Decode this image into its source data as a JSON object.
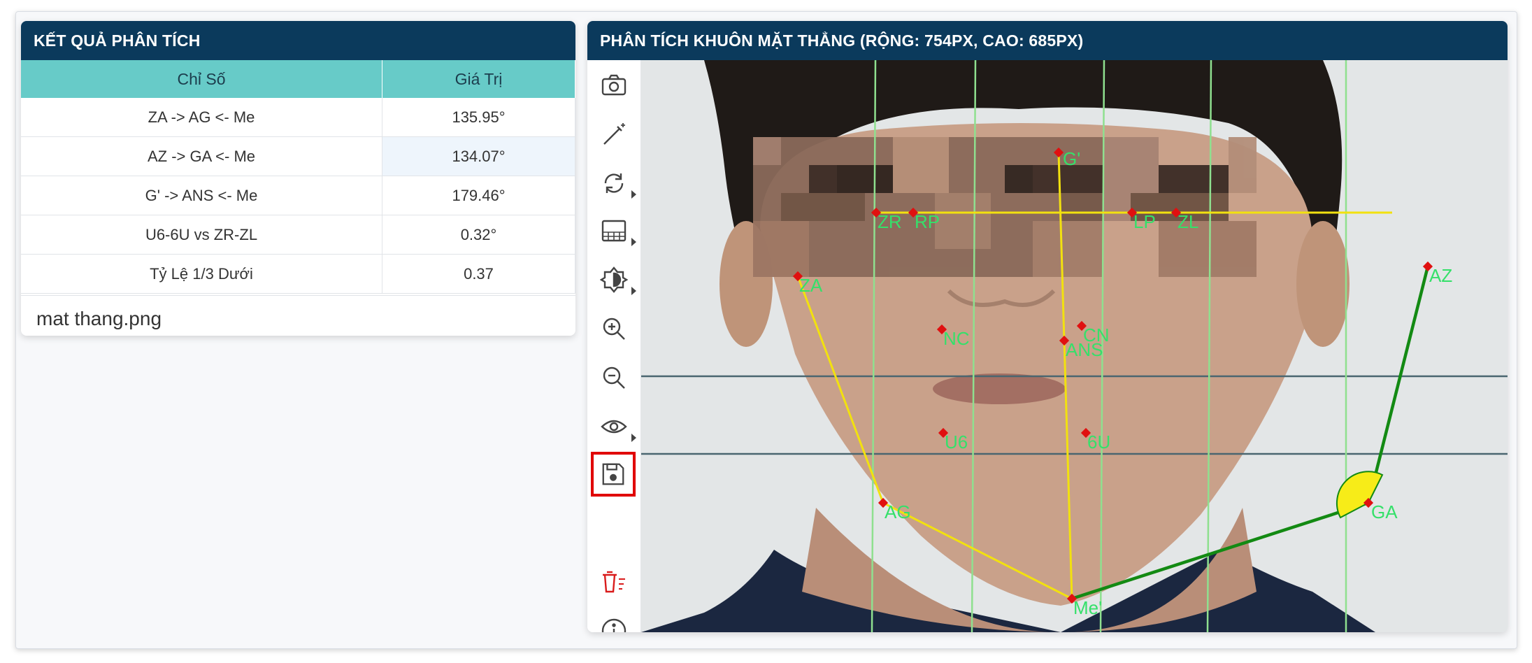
{
  "left_panel": {
    "title": "KẾT QUẢ PHÂN TÍCH",
    "columns": [
      "Chỉ Số",
      "Giá Trị"
    ],
    "rows": [
      {
        "index": "ZA -> AG <- Me",
        "value": "135.95°"
      },
      {
        "index": "AZ -> GA <- Me",
        "value": "134.07°"
      },
      {
        "index": "G' -> ANS <- Me",
        "value": "179.46°"
      },
      {
        "index": "U6-6U vs ZR-ZL",
        "value": "0.32°"
      },
      {
        "index": "Tỷ Lệ 1/3 Dưới",
        "value": "0.37"
      }
    ],
    "filename": "mat thang.png"
  },
  "right_panel": {
    "title": "PHÂN TÍCH KHUÔN MẶT THẲNG (RỘNG: 754PX, CAO: 685PX)"
  },
  "toolbar": [
    {
      "name": "camera-icon"
    },
    {
      "name": "magic-wand-icon"
    },
    {
      "name": "rotate-icon",
      "has_submenu": true
    },
    {
      "name": "grid-overlay-icon",
      "has_submenu": true
    },
    {
      "name": "contrast-icon",
      "has_submenu": true
    },
    {
      "name": "zoom-in-icon"
    },
    {
      "name": "zoom-out-icon"
    },
    {
      "name": "eye-icon",
      "has_submenu": true
    },
    {
      "name": "save-icon",
      "active": true
    },
    {
      "name": "clear-points-icon"
    },
    {
      "name": "info-icon",
      "has_submenu": true
    }
  ],
  "landmarks": [
    {
      "label": "G'"
    },
    {
      "label": "ZR"
    },
    {
      "label": "RP"
    },
    {
      "label": "LP"
    },
    {
      "label": "ZL"
    },
    {
      "label": "ZA"
    },
    {
      "label": "AZ"
    },
    {
      "label": "NC"
    },
    {
      "label": "CN"
    },
    {
      "label": "ANS"
    },
    {
      "label": "U6"
    },
    {
      "label": "6U"
    },
    {
      "label": "AG"
    },
    {
      "label": "GA"
    },
    {
      "label": "Me'"
    }
  ],
  "colors": {
    "header_bg": "#0b3a5c",
    "table_header_bg": "#67cbc8",
    "active_tool_border": "#e00000",
    "yellow_lines": "#f2e10f",
    "green_lines": "#138a13",
    "vertical_guides": "#8fe08f",
    "label_color": "#35e06a",
    "point_color": "#e01010"
  }
}
